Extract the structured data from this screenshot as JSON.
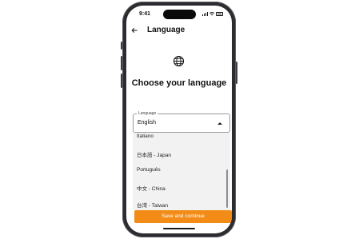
{
  "status_bar": {
    "time": "9:41"
  },
  "header": {
    "title": "Language"
  },
  "page": {
    "heading": "Choose your language"
  },
  "language_select": {
    "label": "Language",
    "value": "English"
  },
  "options": [
    "Italiano",
    "日本語 - Japan",
    "Português",
    "中文 - China",
    "台湾 - Taiwan"
  ],
  "cta": {
    "label": "Save and continue"
  },
  "colors": {
    "accent": "#f28c16",
    "dropdown_bg": "#f2f2f2",
    "frame": "#2b2b30"
  },
  "icons": {
    "back": "arrow-left-icon",
    "globe": "globe-icon",
    "caret": "caret-up-icon"
  }
}
